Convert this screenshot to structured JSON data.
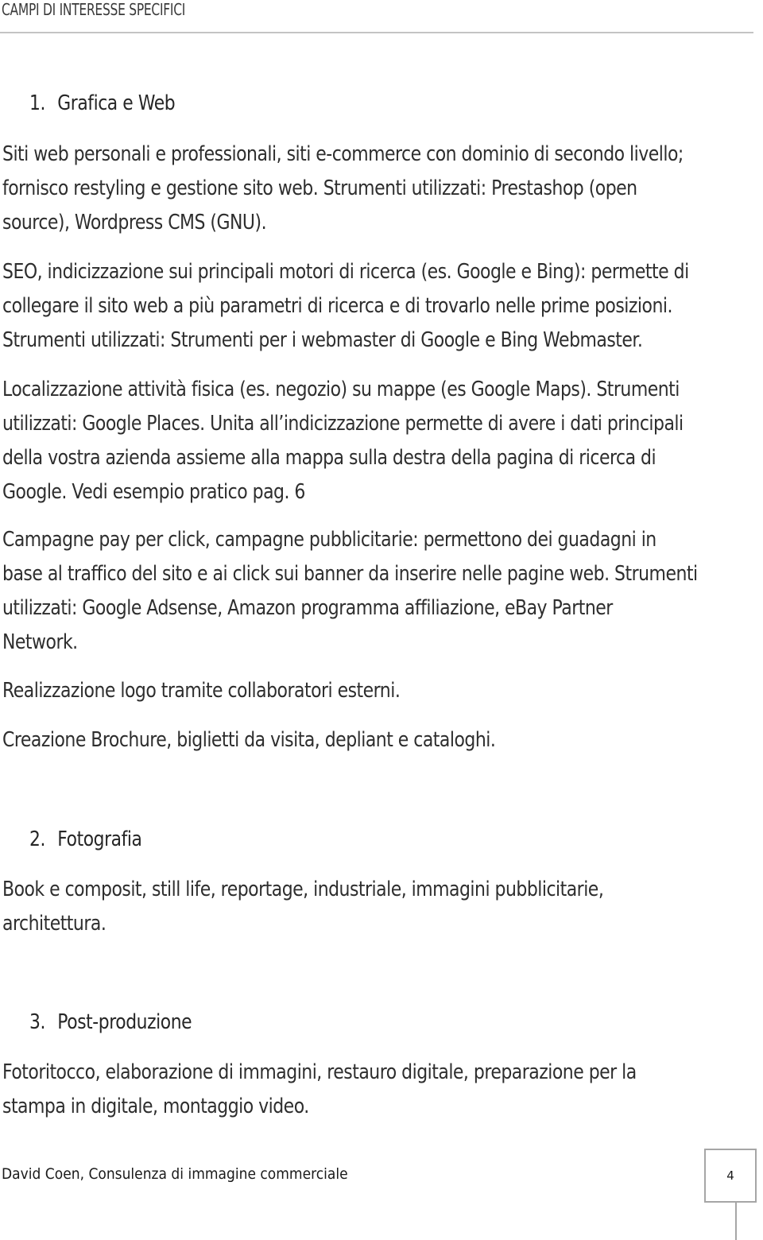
{
  "header": {
    "title": "CAMPI DI INTERESSE SPECIFICI"
  },
  "sections": [
    {
      "number": "1.",
      "title": "Grafica e Web",
      "paragraphs": [
        {
          "lines": [
            "Siti web personali e professionali, siti e-commerce con dominio di secondo livello;",
            "fornisco restyling e gestione sito web. Strumenti utilizzati: Prestashop (open",
            "source), Wordpress CMS (GNU)."
          ]
        },
        {
          "lines": [
            "SEO, indicizzazione sui principali motori di ricerca (es. Google e Bing): permette di",
            "collegare il sito web a più parametri di ricerca e di trovarlo nelle prime posizioni.",
            "Strumenti utilizzati: Strumenti per i webmaster di Google e Bing Webmaster."
          ]
        },
        {
          "lines": [
            "Localizzazione attività fisica (es. negozio) su mappe (es Google Maps). Strumenti",
            "utilizzati: Google Places. Unita all’indicizzazione permette di avere i dati principali",
            "della vostra azienda assieme alla mappa sulla destra della pagina di ricerca di",
            "Google. Vedi esempio pratico pag. 6"
          ]
        },
        {
          "lines": [
            "Campagne pay per click, campagne pubblicitarie: permettono dei guadagni in",
            "base al traffico del sito e ai click sui banner da inserire nelle pagine web. Strumenti",
            "utilizzati: Google Adsense, Amazon programma affiliazione, eBay Partner",
            "Network."
          ]
        },
        {
          "lines": [
            "Realizzazione logo tramite collaboratori esterni."
          ]
        },
        {
          "lines": [
            "Creazione Brochure, biglietti da visita, depliant e cataloghi."
          ]
        }
      ]
    },
    {
      "number": "2.",
      "title": "Fotografia",
      "paragraphs": [
        {
          "lines": [
            "Book e composit, still life, reportage, industriale, immagini pubblicitarie,",
            "architettura."
          ]
        }
      ]
    },
    {
      "number": "3.",
      "title": "Post-produzione",
      "paragraphs": [
        {
          "lines": [
            "Fotoritocco, elaborazione di immagini, restauro digitale, preparazione per la",
            "stampa in digitale, montaggio video."
          ]
        }
      ]
    }
  ],
  "footer": {
    "author": "David Coen, Consulenza di immagine commerciale",
    "page_number": "4"
  }
}
